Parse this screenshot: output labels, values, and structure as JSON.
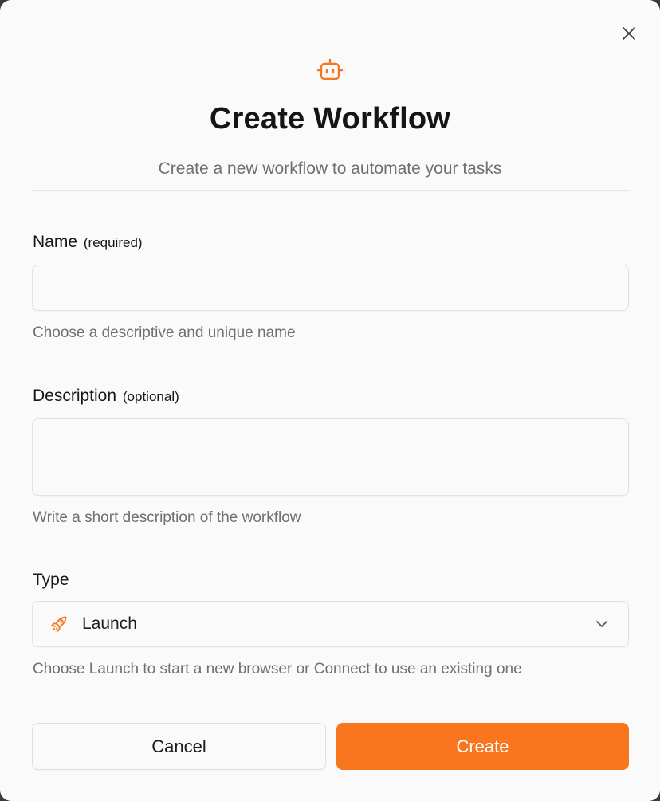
{
  "dialog": {
    "title": "Create Workflow",
    "subtitle": "Create a new workflow to automate your tasks",
    "header_icon": "robot-icon",
    "close_icon": "close-icon"
  },
  "form": {
    "name": {
      "label": "Name",
      "qualifier": "(required)",
      "value": "",
      "hint": "Choose a descriptive and unique name"
    },
    "description": {
      "label": "Description",
      "qualifier": "(optional)",
      "value": "",
      "hint": "Write a short description of the workflow"
    },
    "type": {
      "label": "Type",
      "selected": "Launch",
      "selected_icon": "rocket-icon",
      "hint": "Choose Launch to start a new browser or Connect to use an existing one"
    }
  },
  "actions": {
    "cancel_label": "Cancel",
    "create_label": "Create"
  },
  "colors": {
    "accent": "#f9761e",
    "background": "#fafafa",
    "title_text": "#151515",
    "muted_text": "#6f6f6f"
  }
}
